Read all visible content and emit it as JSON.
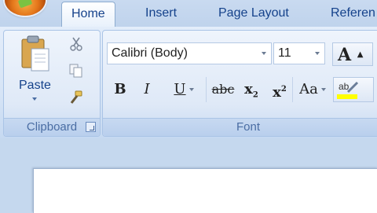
{
  "tabs": {
    "home": "Home",
    "insert": "Insert",
    "page_layout": "Page Layout",
    "references": "Referen"
  },
  "clipboard": {
    "paste_label": "Paste",
    "group_label": "Clipboard"
  },
  "font": {
    "font_name": "Calibri (Body)",
    "font_size": "11",
    "group_label": "Font",
    "bold": "B",
    "italic": "I",
    "underline": "U",
    "strikethrough": "abc",
    "subscript": "x",
    "subscript_sub": "2",
    "superscript": "x",
    "superscript_sup": "2",
    "change_case": "Aa",
    "grow_font": "A",
    "highlight_text": "ab"
  },
  "colors": {
    "tab_text": "#15428b",
    "group_label_text": "#4a6da3",
    "highlight_yellow": "#ffff00"
  },
  "icons": [
    "office-button",
    "paste-icon",
    "cut-icon",
    "copy-icon",
    "format-painter-icon",
    "grow-font-icon",
    "highlight-icon"
  ]
}
